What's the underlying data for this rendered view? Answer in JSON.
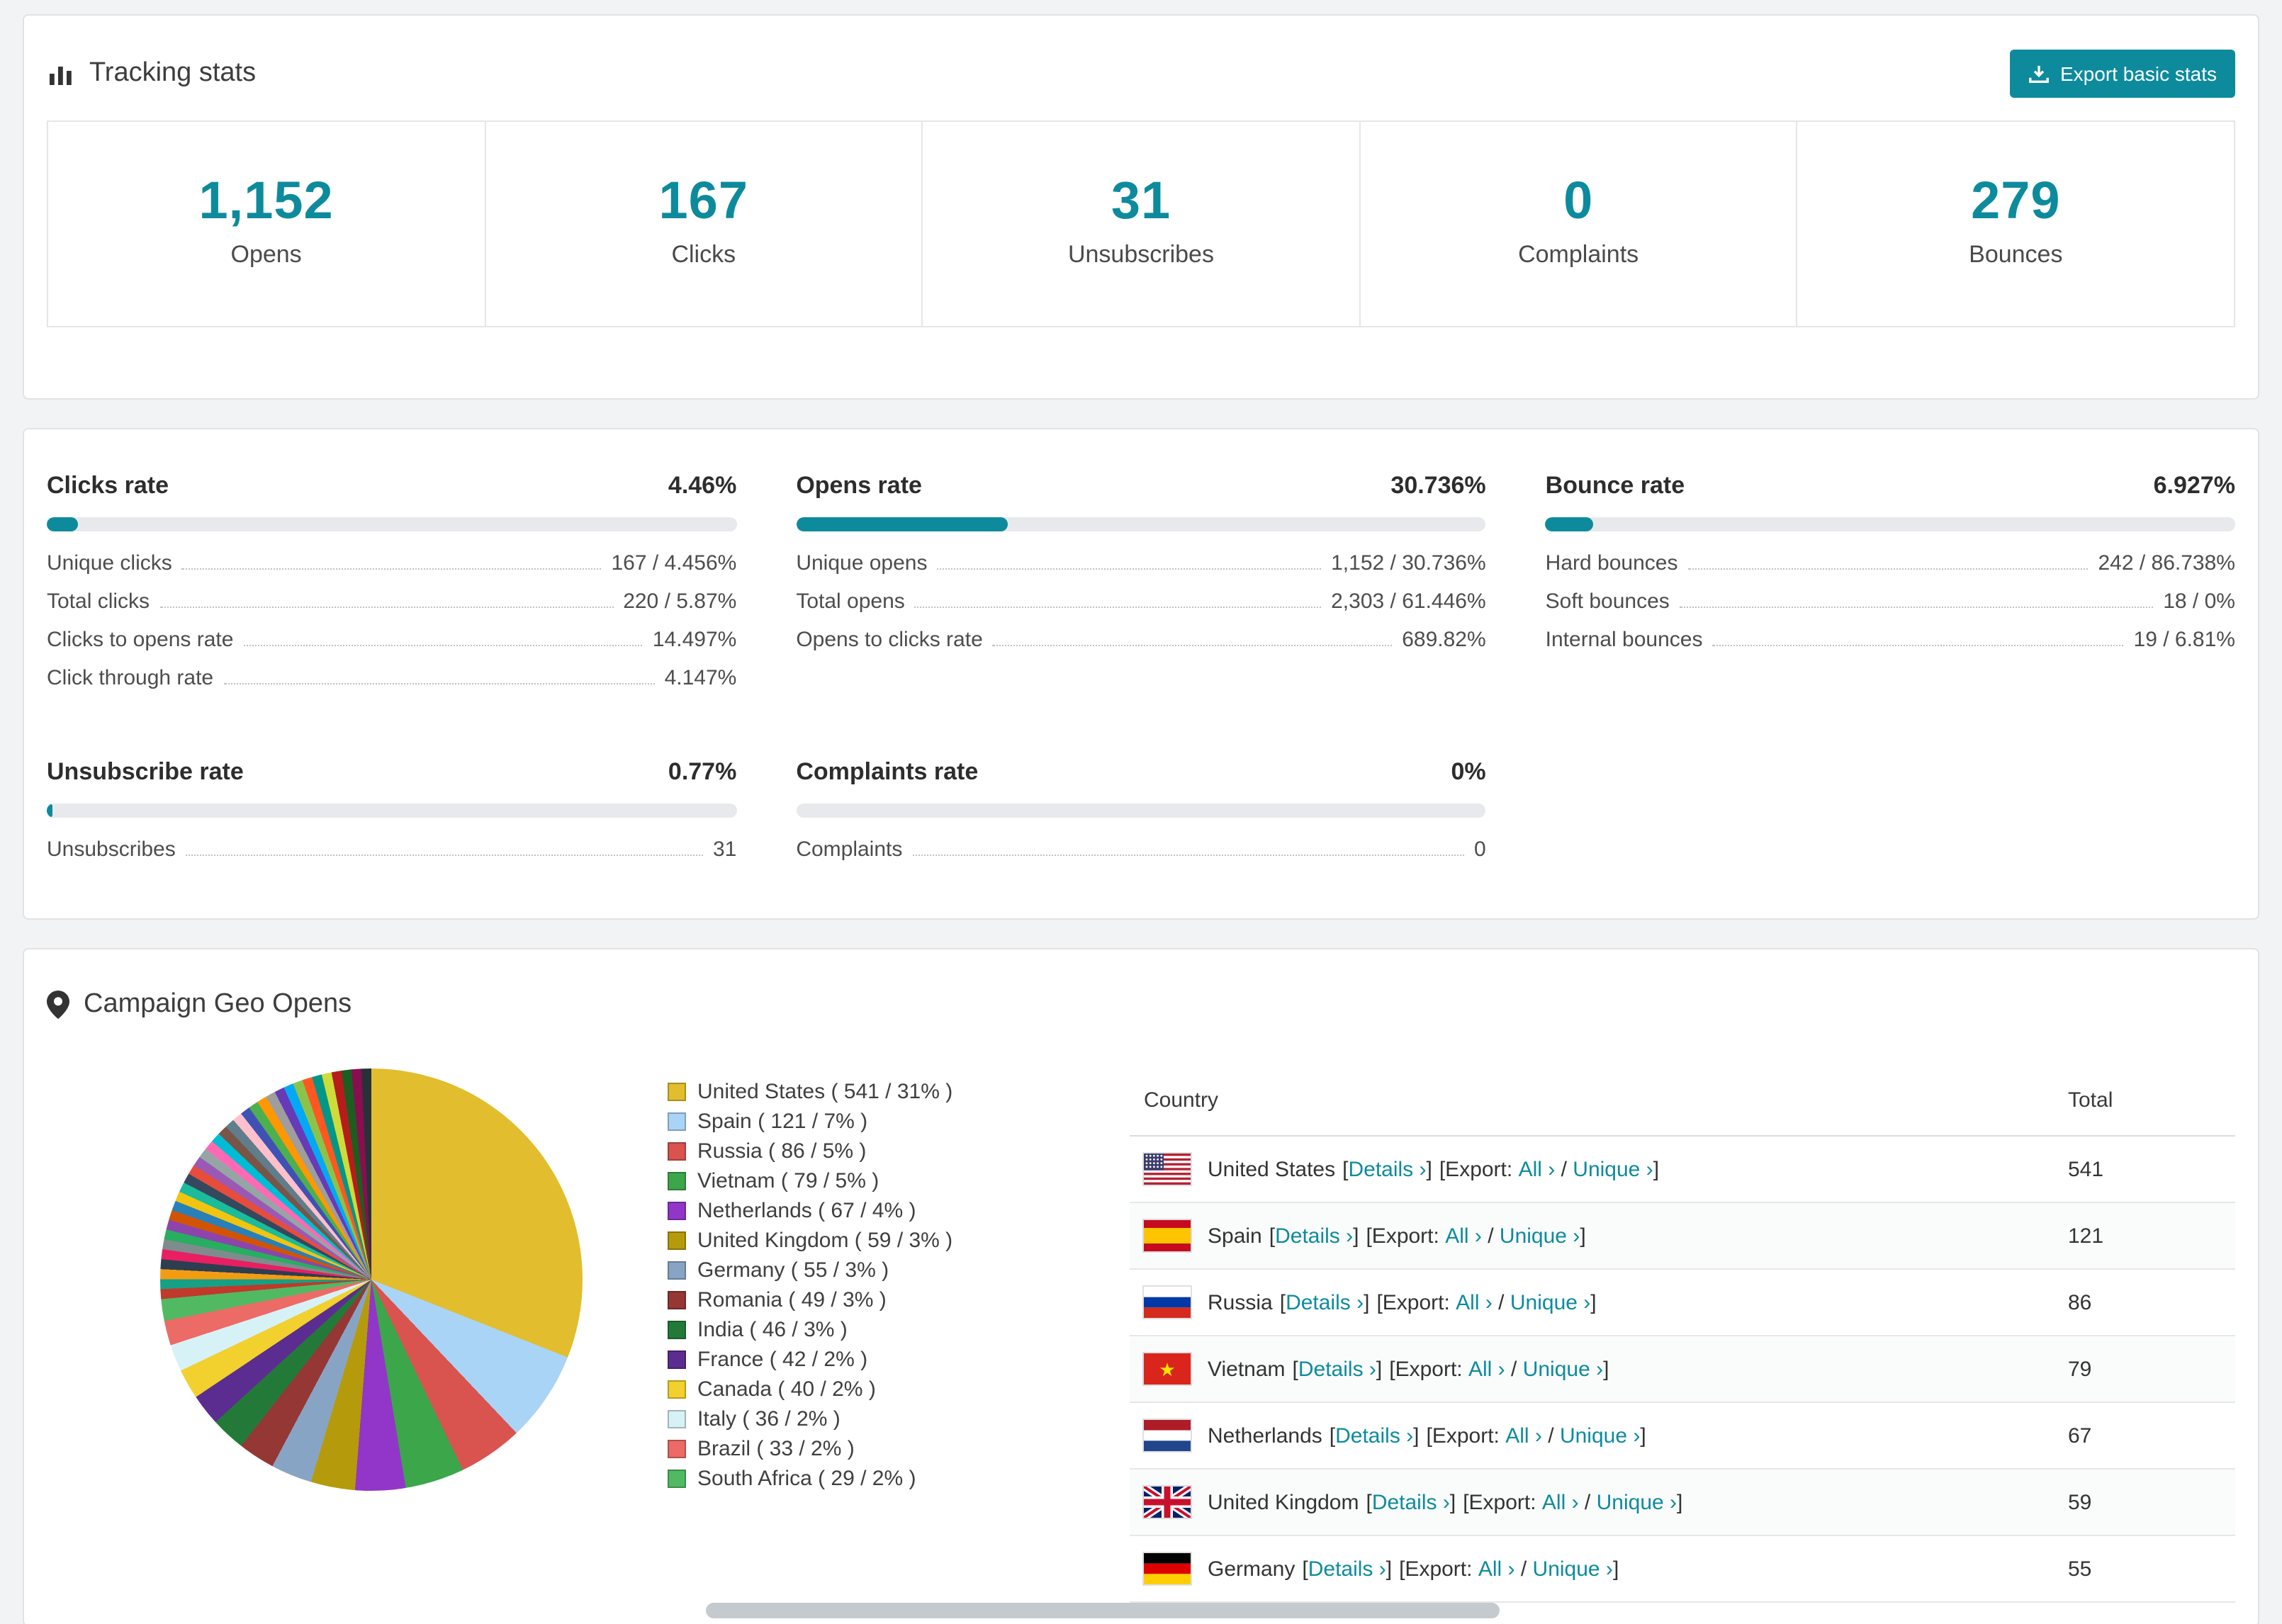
{
  "colors": {
    "accent": "#0d8b9d",
    "link": "#0d8b9d",
    "bar_track": "#e8e9ec",
    "page_bg": "#f2f3f5"
  },
  "tracking": {
    "title": "Tracking stats",
    "title_icon": "bar-chart",
    "export_button": "Export basic stats",
    "export_icon": "download-tray"
  },
  "summary_stats": [
    {
      "value": "1,152",
      "label": "Opens"
    },
    {
      "value": "167",
      "label": "Clicks"
    },
    {
      "value": "31",
      "label": "Unsubscribes"
    },
    {
      "value": "0",
      "label": "Complaints"
    },
    {
      "value": "279",
      "label": "Bounces"
    }
  ],
  "rate_panels": [
    {
      "id": "clicks",
      "title": "Clicks rate",
      "percent_label": "4.46%",
      "percent": 4.46,
      "rows": [
        {
          "label": "Unique clicks",
          "value": "167 / 4.456%"
        },
        {
          "label": "Total clicks",
          "value": "220 / 5.87%"
        },
        {
          "label": "Clicks to opens rate",
          "value": "14.497%"
        },
        {
          "label": "Click through rate",
          "value": "4.147%"
        }
      ]
    },
    {
      "id": "opens",
      "title": "Opens rate",
      "percent_label": "30.736%",
      "percent": 30.736,
      "rows": [
        {
          "label": "Unique opens",
          "value": "1,152 / 30.736%"
        },
        {
          "label": "Total opens",
          "value": "2,303 / 61.446%"
        },
        {
          "label": "Opens to clicks rate",
          "value": "689.82%"
        }
      ]
    },
    {
      "id": "bounce",
      "title": "Bounce rate",
      "percent_label": "6.927%",
      "percent": 6.927,
      "rows": [
        {
          "label": "Hard bounces",
          "value": "242 / 86.738%"
        },
        {
          "label": "Soft bounces",
          "value": "18 / 0%"
        },
        {
          "label": "Internal bounces",
          "value": "19 / 6.81%"
        }
      ]
    },
    {
      "id": "unsubscribe",
      "title": "Unsubscribe rate",
      "percent_label": "0.77%",
      "percent": 0.77,
      "rows": [
        {
          "label": "Unsubscribes",
          "value": "31"
        }
      ]
    },
    {
      "id": "complaints",
      "title": "Complaints rate",
      "percent_label": "0%",
      "percent": 0,
      "rows": [
        {
          "label": "Complaints",
          "value": "0"
        }
      ]
    }
  ],
  "geo": {
    "title": "Campaign Geo Opens",
    "title_icon": "map-pin"
  },
  "geo_table": {
    "columns": [
      "Country",
      "Total"
    ],
    "details_label": "Details",
    "export_label": "Export:",
    "all_label": "All",
    "unique_label": "Unique",
    "chevron": "›",
    "rows": [
      {
        "country": "United States",
        "flag": "us",
        "total": "541"
      },
      {
        "country": "Spain",
        "flag": "es",
        "total": "121"
      },
      {
        "country": "Russia",
        "flag": "ru",
        "total": "86"
      },
      {
        "country": "Vietnam",
        "flag": "vn",
        "total": "79"
      },
      {
        "country": "Netherlands",
        "flag": "nl",
        "total": "67"
      },
      {
        "country": "United Kingdom",
        "flag": "gb",
        "total": "59"
      },
      {
        "country": "Germany",
        "flag": "de",
        "total": "55"
      }
    ]
  },
  "chart_data": {
    "type": "pie",
    "title": "Campaign Geo Opens",
    "start_angle_deg": 0,
    "legend_position": "right",
    "slices": [
      {
        "label": "United States",
        "value": 541,
        "pct": 31,
        "color": "#e2bd2d"
      },
      {
        "label": "Spain",
        "value": 121,
        "pct": 7,
        "color": "#aad4f5"
      },
      {
        "label": "Russia",
        "value": 86,
        "pct": 5,
        "color": "#d9534f"
      },
      {
        "label": "Vietnam",
        "value": 79,
        "pct": 5,
        "color": "#3ca64b"
      },
      {
        "label": "Netherlands",
        "value": 67,
        "pct": 4,
        "color": "#9136c8"
      },
      {
        "label": "United Kingdom",
        "value": 59,
        "pct": 3,
        "color": "#b59b0b"
      },
      {
        "label": "Germany",
        "value": 55,
        "pct": 3,
        "color": "#88a4c5"
      },
      {
        "label": "Romania",
        "value": 49,
        "pct": 3,
        "color": "#953735"
      },
      {
        "label": "India",
        "value": 46,
        "pct": 3,
        "color": "#237a38"
      },
      {
        "label": "France",
        "value": 42,
        "pct": 2,
        "color": "#5b2d90"
      },
      {
        "label": "Canada",
        "value": 40,
        "pct": 2,
        "color": "#f2d02e"
      },
      {
        "label": "Italy",
        "value": 36,
        "pct": 2,
        "color": "#d7f2f7"
      },
      {
        "label": "Brazil",
        "value": 33,
        "pct": 2,
        "color": "#ec6b66"
      },
      {
        "label": "South Africa",
        "value": 29,
        "pct": 2,
        "color": "#52b963"
      }
    ],
    "other_slices_total": 462,
    "other_slice_colors": [
      "#c0392b",
      "#16a085",
      "#f39c12",
      "#2c3e50",
      "#e91e63",
      "#7f8c8d",
      "#27ae60",
      "#8e44ad",
      "#d35400",
      "#2980b9",
      "#f1c40f",
      "#1abc9c",
      "#34495e",
      "#e74c3c",
      "#9b59b6",
      "#95a5a6",
      "#ff69b4",
      "#00bcd4",
      "#795548",
      "#607d8b",
      "#ffc0cb",
      "#3f51b5",
      "#4caf50",
      "#ff9800",
      "#9e9e9e",
      "#673ab7",
      "#03a9f4",
      "#8bc34a",
      "#ff5722",
      "#009688",
      "#cddc39",
      "#b71c1c",
      "#1b5e20",
      "#880e4f",
      "#263238"
    ]
  }
}
